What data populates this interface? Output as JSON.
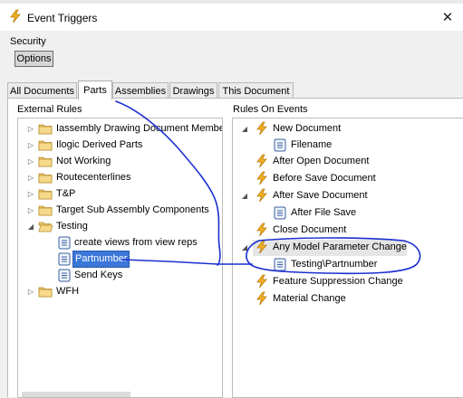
{
  "window": {
    "title": "Event Triggers",
    "close_glyph": "✕",
    "icon": "lightning-icon"
  },
  "security": {
    "label": "Security",
    "options_label": "Options"
  },
  "tabs": [
    {
      "label": "All Documents",
      "active": false
    },
    {
      "label": "Parts",
      "active": true
    },
    {
      "label": "Assemblies",
      "active": false
    },
    {
      "label": "Drawings",
      "active": false
    },
    {
      "label": "This Document",
      "active": false
    }
  ],
  "external_rules": {
    "label": "External Rules",
    "items": [
      {
        "label": "Iassembly Drawing Document Membe",
        "type": "folder",
        "expander": "collapsed"
      },
      {
        "label": "Ilogic Derived Parts",
        "type": "folder",
        "expander": "collapsed"
      },
      {
        "label": "Not Working",
        "type": "folder",
        "expander": "collapsed"
      },
      {
        "label": "Routecenterlines",
        "type": "folder",
        "expander": "collapsed"
      },
      {
        "label": "T&P",
        "type": "folder",
        "expander": "collapsed"
      },
      {
        "label": "Target Sub Assembly Components",
        "type": "folder",
        "expander": "collapsed"
      },
      {
        "label": "Testing",
        "type": "folder-open",
        "expander": "expanded"
      },
      {
        "label": "create views from view reps",
        "type": "rule"
      },
      {
        "label": "Partnumber",
        "type": "rule",
        "selected": true
      },
      {
        "label": "Send Keys",
        "type": "rule"
      },
      {
        "label": "WFH",
        "type": "folder",
        "expander": "collapsed"
      }
    ]
  },
  "rules_on_events": {
    "label": "Rules On Events",
    "items": [
      {
        "label": "New Document",
        "type": "event",
        "expander": "expanded"
      },
      {
        "label": "Filename",
        "type": "rule"
      },
      {
        "label": "After Open Document",
        "type": "event"
      },
      {
        "label": "Before Save Document",
        "type": "event"
      },
      {
        "label": "After Save Document",
        "type": "event",
        "expander": "expanded"
      },
      {
        "label": "After File Save",
        "type": "rule"
      },
      {
        "label": "Close Document",
        "type": "event"
      },
      {
        "label": "Any Model Parameter Change",
        "type": "event",
        "expander": "expanded",
        "highlighted": true
      },
      {
        "label": "Testing\\Partnumber",
        "type": "rule"
      },
      {
        "label": "Feature Suppression Change",
        "type": "event"
      },
      {
        "label": "Material Change",
        "type": "event"
      }
    ]
  },
  "colors": {
    "selection": "#3a77d8",
    "annotation_ink": "#1a2fd0",
    "lightning": "#f2b01e",
    "folder": "#e8c46a"
  }
}
